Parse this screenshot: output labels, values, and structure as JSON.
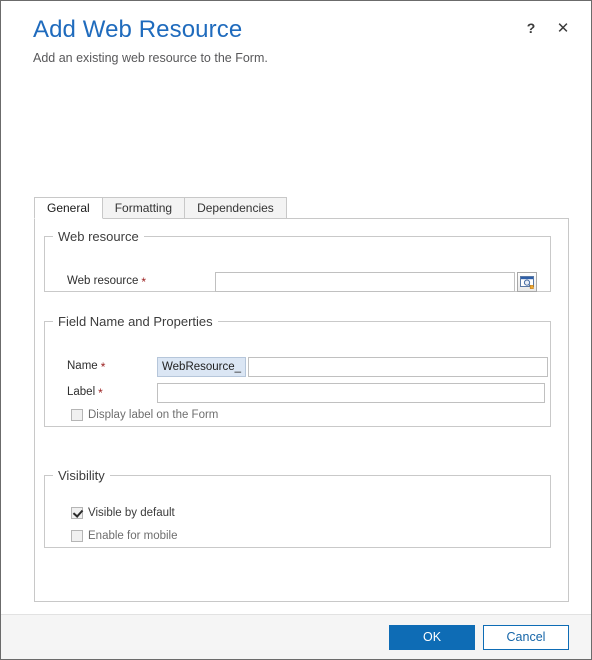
{
  "dialog": {
    "title": "Add Web Resource",
    "subtitle": "Add an existing web resource to the Form.",
    "help_glyph": "?",
    "close_glyph": "✕",
    "accent_color": "#1f6bbd",
    "primary_button_color": "#0e6cb5",
    "required_marker": "*"
  },
  "tabs": [
    {
      "label": "General",
      "active": true
    },
    {
      "label": "Formatting",
      "active": false
    },
    {
      "label": "Dependencies",
      "active": false
    }
  ],
  "groups": {
    "web_resource": {
      "legend": "Web resource",
      "field": {
        "label": "Web resource",
        "required": true,
        "value": "",
        "placeholder": "",
        "lookup_icon": "lookup-window-icon"
      }
    },
    "field_name_and_properties": {
      "legend": "Field Name and Properties",
      "name_field": {
        "label": "Name",
        "required": true,
        "prefix": "WebResource_",
        "value": "",
        "placeholder": ""
      },
      "label_field": {
        "label": "Label",
        "required": true,
        "value": "",
        "placeholder": ""
      },
      "display_label_checkbox": {
        "label": "Display label on the Form",
        "checked": false,
        "disabled": true
      }
    },
    "visibility": {
      "legend": "Visibility",
      "visible_by_default": {
        "label": "Visible by default",
        "checked": true,
        "disabled": false
      },
      "enable_for_mobile": {
        "label": "Enable for mobile",
        "checked": false,
        "disabled": true
      }
    }
  },
  "footer": {
    "ok_label": "OK",
    "cancel_label": "Cancel"
  }
}
